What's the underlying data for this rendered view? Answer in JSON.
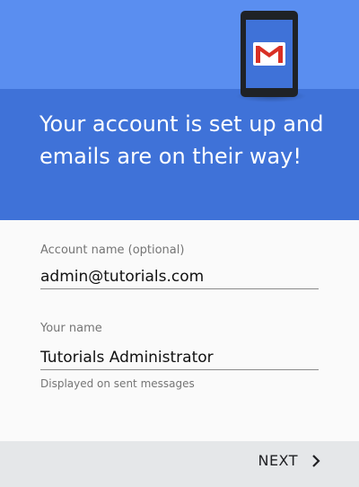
{
  "header": {
    "title": "Your account is set up and emails are on their way!",
    "icon": "gmail-icon",
    "colors": {
      "top": "#5a8ef0",
      "bottom": "#3f72d8",
      "gmail_red": "#d93025"
    }
  },
  "form": {
    "account_name": {
      "label": "Account name (optional)",
      "value": "admin@tutorials.com"
    },
    "your_name": {
      "label": "Your name",
      "value": "Tutorials Administrator",
      "helper": "Displayed on sent messages"
    }
  },
  "footer": {
    "next_label": "NEXT",
    "next_icon": "chevron-right-icon"
  }
}
